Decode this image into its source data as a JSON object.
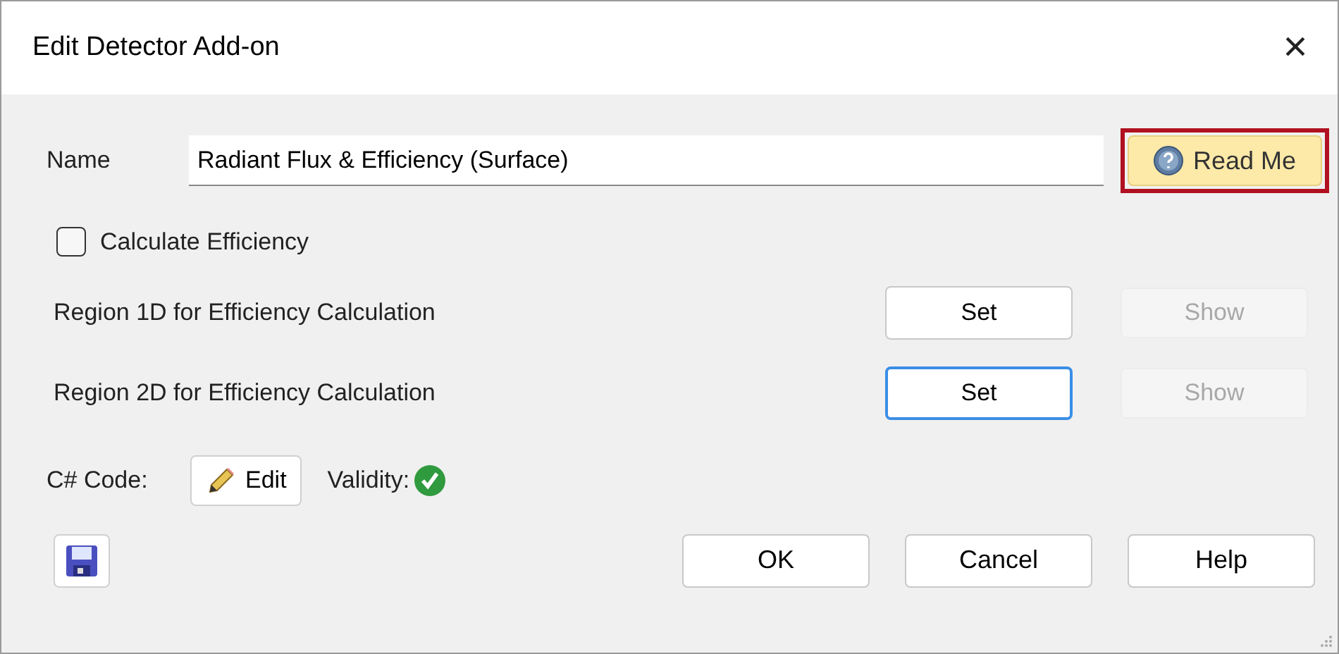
{
  "window": {
    "title": "Edit Detector Add-on",
    "close": "×"
  },
  "name_field": {
    "label": "Name",
    "value": "Radiant Flux & Efficiency (Surface)"
  },
  "read_me": {
    "label": "Read Me",
    "highlighted": true
  },
  "calculate_efficiency": {
    "label": "Calculate Efficiency",
    "checked": false
  },
  "regions": [
    {
      "label": "Region 1D for Efficiency Calculation",
      "set": {
        "label": "Set",
        "focused": false
      },
      "show": {
        "label": "Show",
        "disabled": true
      }
    },
    {
      "label": "Region 2D for Efficiency Calculation",
      "set": {
        "label": "Set",
        "focused": true
      },
      "show": {
        "label": "Show",
        "disabled": true
      }
    }
  ],
  "code": {
    "label": "C# Code:",
    "edit": "Edit",
    "validity_label": "Validity:",
    "valid": true
  },
  "buttons": [
    "OK",
    "Cancel",
    "Help"
  ]
}
